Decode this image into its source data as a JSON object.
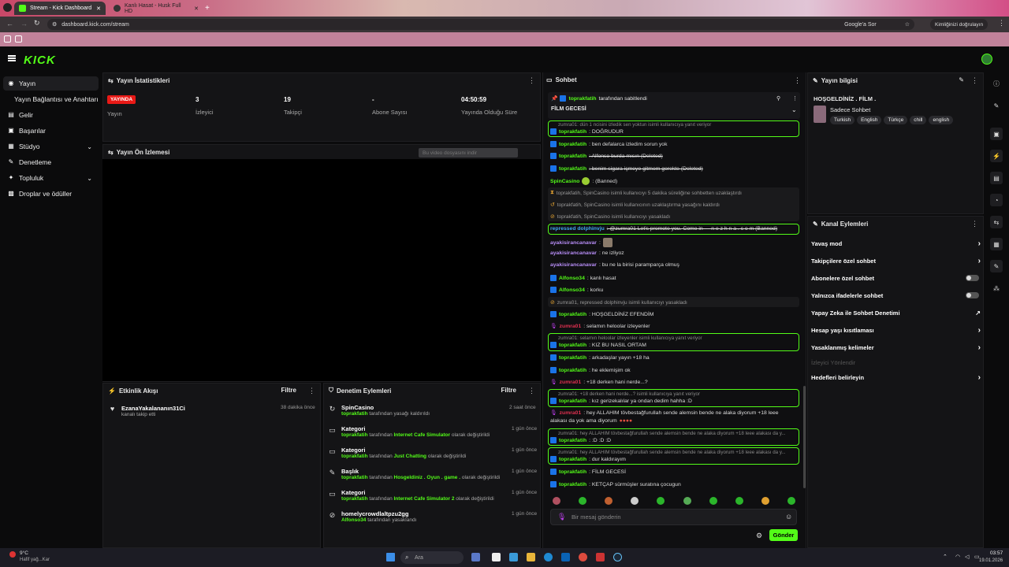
{
  "browser": {
    "tabs": [
      {
        "title": "Stream - Kick Dashboard"
      },
      {
        "title": "Kanlı Hasat - Husk Full HD"
      }
    ],
    "url": "dashboard.kick.com/stream",
    "search_chip": "Google'a Sor",
    "profile_chip": "Kimliğinizi doğrulayın"
  },
  "kick": {
    "logo": "KICK"
  },
  "sidebar": {
    "items": [
      {
        "label": "Yayın"
      },
      {
        "label": "Yayın Bağlantısı ve Anahtarı"
      },
      {
        "label": "Gelir"
      },
      {
        "label": "Başarılar"
      },
      {
        "label": "Stüdyo"
      },
      {
        "label": "Denetleme"
      },
      {
        "label": "Topluluk"
      },
      {
        "label": "Droplar ve ödüller"
      }
    ]
  },
  "stats": {
    "title": "Yayın İstatistikleri",
    "live_badge": "YAYINDA",
    "items": [
      {
        "label": "Yayın",
        "value": ""
      },
      {
        "label": "İzleyici",
        "value": "3"
      },
      {
        "label": "Takipçi",
        "value": "19"
      },
      {
        "label": "Abone Sayısı",
        "value": "-"
      },
      {
        "label": "Yayında Olduğu Süre",
        "value": "04:50:59"
      }
    ]
  },
  "preview": {
    "title": "Yayın Ön İzlemesi",
    "download_label": "Bu video dosyasını indir"
  },
  "activity": {
    "title": "Etkinlik Akışı",
    "filter": "Filtre",
    "items": [
      {
        "name": "EzanaYakalananın31Ci",
        "action": "kanalı takip etti",
        "time": "38 dakika önce"
      }
    ]
  },
  "moderation": {
    "title": "Denetim Eylemleri",
    "filter": "Filtre",
    "items": [
      {
        "title": "SpinCasino",
        "user": "toprakfatih",
        "text": "tarafından yasağı kaldırıldı",
        "time": "2 saat önce"
      },
      {
        "title": "Kategori",
        "user": "toprakfatih",
        "pre": "tarafından",
        "highlight": "Internet Cafe Simulator",
        "text": "olarak değiştirildi",
        "time": "1 gün önce"
      },
      {
        "title": "Kategori",
        "user": "toprakfatih",
        "pre": "tarafından",
        "highlight": "Just Chatting",
        "text": "olarak değiştirildi",
        "time": "1 gün önce"
      },
      {
        "title": "Başlık",
        "user": "toprakfatih",
        "pre": "tarafından",
        "highlight": "Hosgeldiniz . Oyun . game .",
        "text": "olarak değiştirildi",
        "time": "1 gün önce"
      },
      {
        "title": "Kategori",
        "user": "toprakfatih",
        "pre": "tarafından",
        "highlight": "Internet Cafe Simulator 2",
        "text": "olarak değiştirildi",
        "time": "1 gün önce"
      },
      {
        "title": "homelycrowdlaltpzu2gg",
        "user": "Alfonso34",
        "text": "tarafından yasaklandı",
        "time": "1 gün önce"
      }
    ]
  },
  "chat": {
    "title": "Sohbet",
    "pinned_by": "toprakfatih",
    "pinned_suffix": "tarafından sabitlendi",
    "pinned_text": "FİLM GECESİ",
    "messages": [
      {
        "reply": "zumra01: dün 1 ncisini izledik sen yoktun isimli kullanıcıya yanıt veriyor",
        "user": "toprakfatih",
        "text": ": DOĞRUDUR"
      },
      {
        "user": "toprakfatih",
        "text": ": ben defalarca izledim sorun yok"
      },
      {
        "user": "toprakfatih",
        "text": ": Alfonso burda mısın (Deleted)"
      },
      {
        "user": "toprakfatih",
        "text": ": benim sigara içmeye gitmem gerekte (Deleted)"
      },
      {
        "user": "SpinCasino",
        "text": ": (Banned)"
      },
      {
        "system": "toprakfatih, SpinCasino isimli kullanıcıyı 5 dakika süreliğine sohbetten uzaklaştırdı"
      },
      {
        "system": "toprakfatih, SpinCasino isimli kullanıcının uzaklaştırma yasağını kaldırdı"
      },
      {
        "system": "toprakfatih, SpinCasino isimli kullanıcıyı yasakladı"
      },
      {
        "user": "repressed dolphinvju",
        "text": ": @zumra01 Let's promote you. Come in — n e z h n a . c o m (Banned)"
      },
      {
        "user": "ayakisirancanavar",
        "text": ":"
      },
      {
        "user": "ayakisirancanavar",
        "text": ": ne izliyoz"
      },
      {
        "user": "ayakisirancanavar",
        "text": ": bu ne la birisi paramparça olmuş"
      },
      {
        "user": "Alfonso34",
        "text": ": kanlı hasat"
      },
      {
        "user": "Alfonso34",
        "text": ": korku"
      },
      {
        "system": "zumra01, repressed dolphinvju isimli kullanıcıyı yasakladı"
      },
      {
        "user": "toprakfatih",
        "text": ": HOŞGELDİNİZ EFENDİM"
      },
      {
        "user": "zumra01",
        "text": ": selamın heloolar izleyenler"
      },
      {
        "reply": "zumra01: selamın heloolar izleyenler isimli kullanıcıya yanıt veriyor",
        "user": "toprakfatih",
        "text": ": KIZ BU NASIL ORTAM"
      },
      {
        "user": "toprakfatih",
        "text": ": arkadaşlar yayın +18 ha"
      },
      {
        "user": "toprakfatih",
        "text": ": he eklemişim ok"
      },
      {
        "user": "zumra01",
        "text": ": +18 derken hani nerde...?"
      },
      {
        "reply": "zumra01: +18 derken hani nerde...? isimli kullanıcıya yanıt veriyor",
        "user": "toprakfatih",
        "text": ": kız gerizekalılar ya ondan dedim hahha :D"
      },
      {
        "user": "zumra01",
        "text": ": hey ALLAHIM tövbestağfurullah sende alemsin bende ne alaka diyorum +18 leee"
      },
      {
        "text2": "alakası da yok ama diyorum"
      },
      {
        "reply": "zumra01: hey ALLAHIM tövbestağfurullah sende alemsin bende ne alaka diyorum +18 leee alakası da y...",
        "user": "toprakfatih",
        "text": ": :D :D :D"
      },
      {
        "reply": "zumra01: hey ALLAHIM tövbestağfurullah sende alemsin bende ne alaka diyorum +18 leee alakası da y...",
        "user": "toprakfatih",
        "text": ": dur kaldırayım"
      },
      {
        "user": "toprakfatih",
        "text": ": FİLM GECESİ"
      },
      {
        "user": "toprakfatih",
        "text": ": KETÇAP sürmüşler suratına çocugun"
      }
    ],
    "input_placeholder": "Bir mesaj gönderin",
    "send_label": "Gönder"
  },
  "stream_info": {
    "title": "Yayın bilgisi",
    "stream_title": "HOŞGELDİNİZ . FİLM .",
    "category": "Sadece Sohbet",
    "tags": [
      "Turkish",
      "English",
      "Türkçe",
      "chill",
      "english"
    ]
  },
  "channel_actions": {
    "title": "Kanal Eylemleri",
    "items": [
      {
        "label": "Yavaş mod",
        "type": "arrow"
      },
      {
        "label": "Takipçilere özel sohbet",
        "type": "arrow"
      },
      {
        "label": "Abonelere özel sohbet",
        "type": "toggle"
      },
      {
        "label": "Yalnızca ifadelerle sohbet",
        "type": "toggle"
      },
      {
        "label": "Yapay Zeka ile Sohbet Denetimi",
        "type": "ext"
      },
      {
        "label": "Hesap yaşı kısıtlaması",
        "type": "arrow"
      },
      {
        "label": "Yasaklanmış kelimeler",
        "type": "arrow"
      },
      {
        "label": "İzleyici Yönlendir",
        "type": "disabled"
      },
      {
        "label": "Hedefleri belirleyin",
        "type": "arrow"
      }
    ]
  },
  "taskbar": {
    "weather_temp": "9°C",
    "weather_desc": "Hafif yağ...Kar",
    "search": "Ara",
    "time": "03:57",
    "date": "19.01.2026"
  },
  "colors": {
    "accent": "#53fc18",
    "live": "#e91916"
  }
}
